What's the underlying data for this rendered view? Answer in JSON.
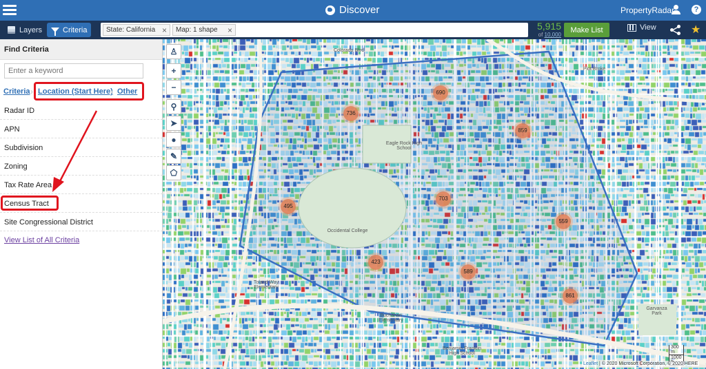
{
  "header": {
    "title": "Discover",
    "brand": "PropertyRadar",
    "menu_icon": "hamburger-icon",
    "help_glyph": "?"
  },
  "toolbar": {
    "layers_label": "Layers",
    "criteria_label": "Criteria",
    "chips": [
      {
        "label": "State: California"
      },
      {
        "label": "Map: 1 shape"
      }
    ],
    "count": "5,915",
    "count_of": "of",
    "count_max": "10,000",
    "make_list_label": "Make List",
    "view_label": "View"
  },
  "sidebar": {
    "header": "Find Criteria",
    "keyword_placeholder": "Enter a keyword",
    "breadcrumbs": [
      "Criteria",
      "Location (Start Here)",
      "Other"
    ],
    "items": [
      "Radar ID",
      "APN",
      "Subdivision",
      "Zoning",
      "Tax Rate Area",
      "Census Tract",
      "Site Congressional District"
    ],
    "view_all": "View List of All Criteria"
  },
  "map": {
    "clusters": [
      "690",
      "736",
      "859",
      "495",
      "703",
      "559",
      "423",
      "589",
      "861"
    ],
    "place_labels": [
      "Colorado Blvd",
      "Eagle Rock High School",
      "Occidental College",
      "Buchanan Elementary",
      "Benjamin Franklin High School",
      "Garvanza Park",
      "Toland Way Elementary",
      "Plot Broke"
    ],
    "scale_labels": [
      "300 m",
      "1000 ft"
    ],
    "attribution_link": "Leaflet",
    "attribution_text": "| © 2020 Microsoft Corporation, © 2020 HERE"
  },
  "colors": {
    "topbar": "#2f6fb5",
    "toolbar": "#1d3557",
    "make_list": "#5a9e3a",
    "count": "#6fbf4a",
    "highlight": "#e0141e",
    "cluster": "#e3825a"
  }
}
